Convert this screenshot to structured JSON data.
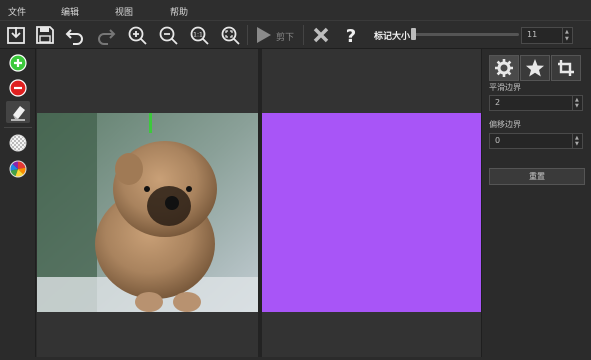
{
  "menu": {
    "file": "文件",
    "edit": "编辑",
    "view": "视图",
    "help": "帮助"
  },
  "toolbar": {
    "cut_label": "剪下",
    "mark_size_label": "标记大小",
    "mark_size_value": "11"
  },
  "side_panel": {
    "smooth_edge_label": "平滑边界",
    "smooth_edge_value": "2",
    "offset_edge_label": "偏移边界",
    "offset_edge_value": "0",
    "reset_label": "重置"
  },
  "colors": {
    "output_fill": "#a855f7",
    "green_marker": "#3cc93c",
    "red_marker": "#e02020"
  },
  "icons": [
    "import-icon",
    "save-icon",
    "undo-icon",
    "redo-icon",
    "zoom-in-icon",
    "zoom-out-icon",
    "actual-size-icon",
    "fit-icon",
    "play-icon",
    "close-icon",
    "help-icon",
    "gear-icon",
    "star-icon",
    "crop-icon"
  ]
}
